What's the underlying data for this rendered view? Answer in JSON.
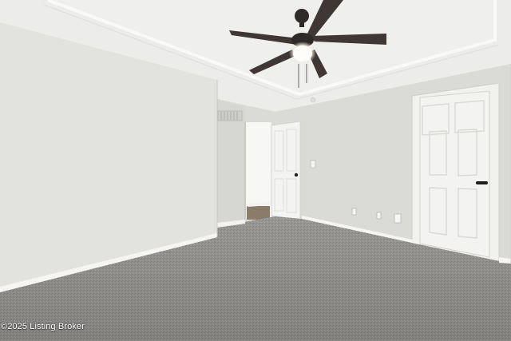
{
  "watermark": {
    "text": "©2025 Listing Broker"
  },
  "colors": {
    "wall_left": "#e3e4de",
    "wall_back": "#dcddd6",
    "ceiling": "#ededea",
    "carpet": "#9e9c9a",
    "trim": "#f3f3f1",
    "door": "#f2f2f0",
    "fan_blade": "#3d3734"
  }
}
